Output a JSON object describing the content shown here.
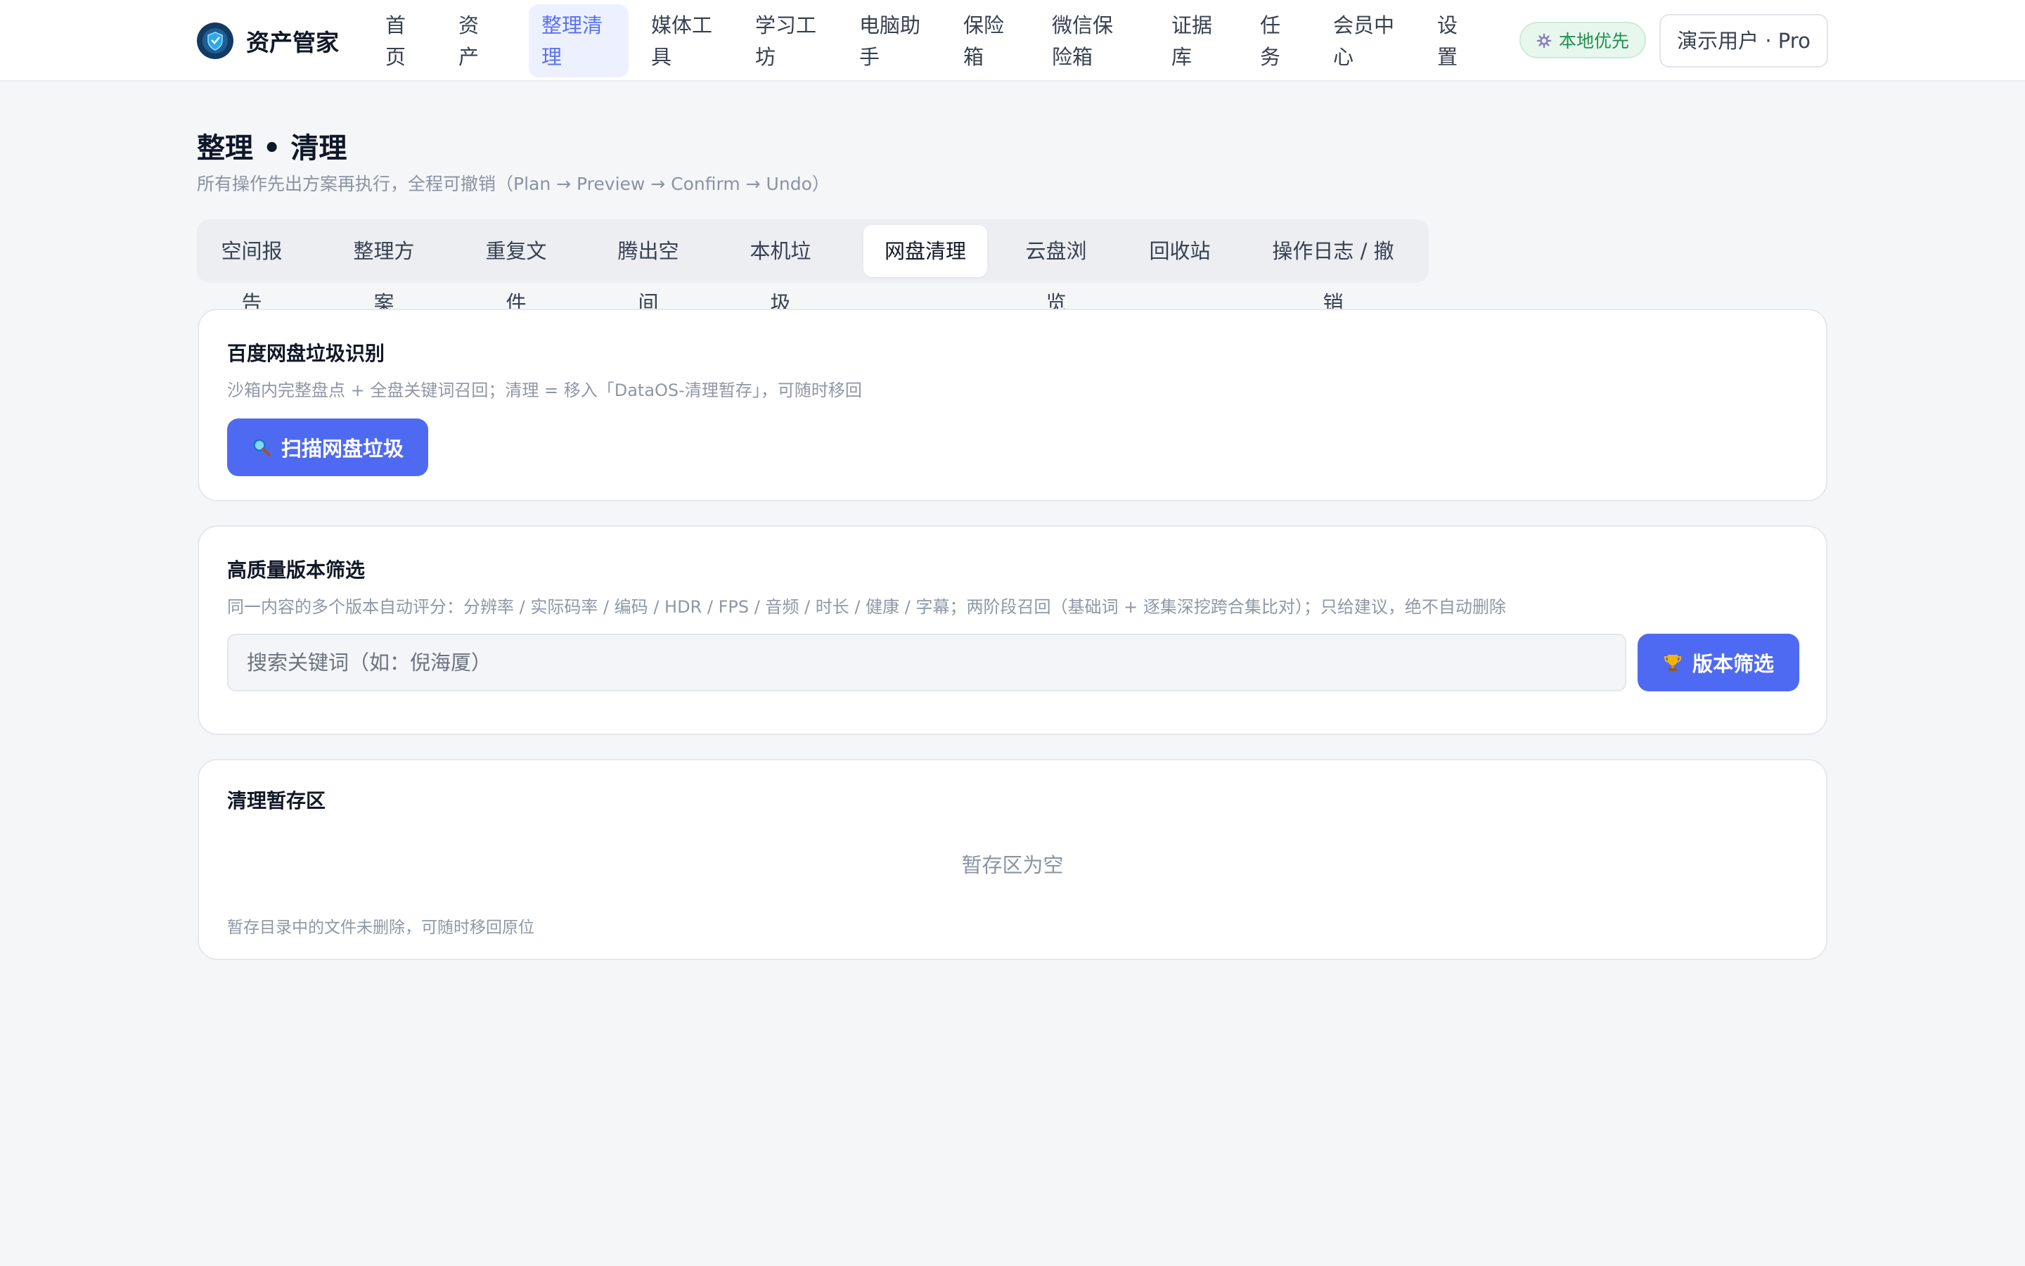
{
  "app": {
    "name": "资产管家"
  },
  "nav": {
    "items": [
      {
        "label": "首页"
      },
      {
        "label": "资产库"
      },
      {
        "label": "整理清理",
        "active": true
      },
      {
        "label": "媒体工具"
      },
      {
        "label": "学习工坊"
      },
      {
        "label": "电脑助手"
      },
      {
        "label": "保险箱"
      },
      {
        "label": "微信保险箱"
      },
      {
        "label": "证据库"
      },
      {
        "label": "任务"
      },
      {
        "label": "会员中心"
      },
      {
        "label": "设置"
      }
    ]
  },
  "header": {
    "local_badge": "本地优先",
    "user": "演示用户 · Pro"
  },
  "page": {
    "title": "整理 • 清理",
    "subtitle": "所有操作先出方案再执行，全程可撤销（Plan → Preview → Confirm → Undo）"
  },
  "tabs": [
    {
      "label": "空间报告"
    },
    {
      "label": "整理方案"
    },
    {
      "label": "重复文件"
    },
    {
      "label": "腾出空间"
    },
    {
      "label": "本机垃圾"
    },
    {
      "label": "网盘清理",
      "active": true
    },
    {
      "label": "云盘浏览"
    },
    {
      "label": "回收站"
    },
    {
      "label": "操作日志 / 撤销"
    }
  ],
  "cards": {
    "baidu": {
      "title": "百度网盘垃圾识别",
      "desc": "沙箱内完整盘点 + 全盘关键词召回；清理 = 移入「DataOS-清理暂存」，可随时移回",
      "button": "扫描网盘垃圾"
    },
    "quality": {
      "title": "高质量版本筛选",
      "desc": "同一内容的多个版本自动评分：分辨率 / 实际码率 / 编码 / HDR / FPS / 音频 / 时长 / 健康 / 字幕；两阶段召回（基础词 + 逐集深挖跨合集比对）；只给建议，绝不自动删除",
      "placeholder": "搜索关键词（如：倪海厦）",
      "button": "版本筛选"
    },
    "staging": {
      "title": "清理暂存区",
      "empty": "暂存区为空",
      "note": "暂存目录中的文件未删除，可随时移回原位"
    }
  },
  "colors": {
    "accent": "#4f6af2",
    "accent_light": "#edf1ff",
    "success": "#1f8f4e",
    "background": "#f5f6f8"
  },
  "icons": {
    "brand": "shield-logo-icon",
    "local_badge": "gear-icon",
    "scan_button": "magnifier-icon",
    "filter_button": "trophy-icon"
  }
}
